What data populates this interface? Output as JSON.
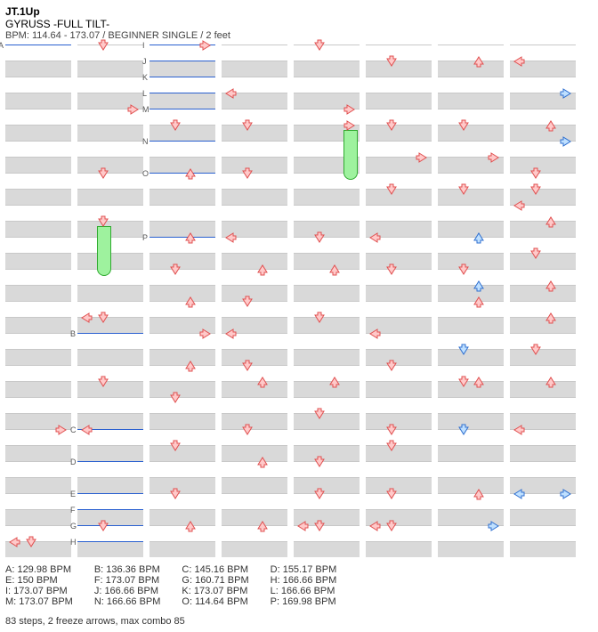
{
  "header": {
    "title": "JT.1Up",
    "song": "GYRUSS -FULL TILT-",
    "info": "BPM: 114.64 - 173.07 / BEGINNER SINGLE / 2 feet"
  },
  "layout": {
    "columns": 8,
    "beats_per_column": 32,
    "lanes": [
      "left",
      "down",
      "up",
      "right"
    ]
  },
  "labels": [
    {
      "col": 0,
      "beat": 0,
      "t": "A"
    },
    {
      "col": 1,
      "beat": 18,
      "t": "B"
    },
    {
      "col": 1,
      "beat": 24,
      "t": "C"
    },
    {
      "col": 1,
      "beat": 26,
      "t": "D"
    },
    {
      "col": 1,
      "beat": 28,
      "t": "E"
    },
    {
      "col": 1,
      "beat": 29,
      "t": "F"
    },
    {
      "col": 1,
      "beat": 30,
      "t": "G"
    },
    {
      "col": 1,
      "beat": 31,
      "t": "H"
    },
    {
      "col": 2,
      "beat": 0,
      "t": "I"
    },
    {
      "col": 2,
      "beat": 1,
      "t": "J"
    },
    {
      "col": 2,
      "beat": 2,
      "t": "K"
    },
    {
      "col": 2,
      "beat": 3,
      "t": "L"
    },
    {
      "col": 2,
      "beat": 4,
      "t": "M"
    },
    {
      "col": 2,
      "beat": 6,
      "t": "N"
    },
    {
      "col": 2,
      "beat": 8,
      "t": "O"
    },
    {
      "col": 2,
      "beat": 12,
      "t": "P"
    }
  ],
  "bpm_lines": [
    {
      "col": 0,
      "beat": 0
    },
    {
      "col": 1,
      "beat": 18
    },
    {
      "col": 1,
      "beat": 24
    },
    {
      "col": 1,
      "beat": 26
    },
    {
      "col": 1,
      "beat": 28
    },
    {
      "col": 1,
      "beat": 29
    },
    {
      "col": 1,
      "beat": 30
    },
    {
      "col": 1,
      "beat": 31
    },
    {
      "col": 2,
      "beat": 0
    },
    {
      "col": 2,
      "beat": 1
    },
    {
      "col": 2,
      "beat": 2
    },
    {
      "col": 2,
      "beat": 3
    },
    {
      "col": 2,
      "beat": 4
    },
    {
      "col": 2,
      "beat": 6
    },
    {
      "col": 2,
      "beat": 8
    },
    {
      "col": 2,
      "beat": 12
    }
  ],
  "freezes": [
    {
      "col": 1,
      "beat": 11,
      "len": 3,
      "lane": "down"
    },
    {
      "col": 4,
      "beat": 5,
      "len": 3,
      "lane": "right"
    }
  ],
  "arrows": [
    {
      "col": 0,
      "beat": 24,
      "lane": "right",
      "c": "r"
    },
    {
      "col": 0,
      "beat": 31,
      "lane": "left",
      "c": "r"
    },
    {
      "col": 0,
      "beat": 31,
      "lane": "down",
      "c": "r"
    },
    {
      "col": 1,
      "beat": 0,
      "lane": "down",
      "c": "r"
    },
    {
      "col": 1,
      "beat": 4,
      "lane": "right",
      "c": "r"
    },
    {
      "col": 1,
      "beat": 8,
      "lane": "down",
      "c": "r"
    },
    {
      "col": 1,
      "beat": 11,
      "lane": "down",
      "c": "r"
    },
    {
      "col": 1,
      "beat": 17,
      "lane": "left",
      "c": "r"
    },
    {
      "col": 1,
      "beat": 17,
      "lane": "down",
      "c": "r"
    },
    {
      "col": 1,
      "beat": 21,
      "lane": "down",
      "c": "r"
    },
    {
      "col": 1,
      "beat": 24,
      "lane": "left",
      "c": "r"
    },
    {
      "col": 1,
      "beat": 30,
      "lane": "down",
      "c": "r"
    },
    {
      "col": 2,
      "beat": 0,
      "lane": "right",
      "c": "r"
    },
    {
      "col": 2,
      "beat": 5,
      "lane": "down",
      "c": "r"
    },
    {
      "col": 2,
      "beat": 8,
      "lane": "up",
      "c": "r"
    },
    {
      "col": 2,
      "beat": 12,
      "lane": "up",
      "c": "r"
    },
    {
      "col": 2,
      "beat": 14,
      "lane": "down",
      "c": "r"
    },
    {
      "col": 2,
      "beat": 16,
      "lane": "up",
      "c": "r"
    },
    {
      "col": 2,
      "beat": 18,
      "lane": "right",
      "c": "r"
    },
    {
      "col": 2,
      "beat": 20,
      "lane": "up",
      "c": "r"
    },
    {
      "col": 2,
      "beat": 22,
      "lane": "down",
      "c": "r"
    },
    {
      "col": 2,
      "beat": 25,
      "lane": "down",
      "c": "r"
    },
    {
      "col": 2,
      "beat": 28,
      "lane": "down",
      "c": "r"
    },
    {
      "col": 2,
      "beat": 30,
      "lane": "up",
      "c": "r"
    },
    {
      "col": 3,
      "beat": 3,
      "lane": "left",
      "c": "r"
    },
    {
      "col": 3,
      "beat": 5,
      "lane": "down",
      "c": "r"
    },
    {
      "col": 3,
      "beat": 8,
      "lane": "down",
      "c": "r"
    },
    {
      "col": 3,
      "beat": 12,
      "lane": "left",
      "c": "r"
    },
    {
      "col": 3,
      "beat": 14,
      "lane": "up",
      "c": "r"
    },
    {
      "col": 3,
      "beat": 16,
      "lane": "down",
      "c": "r"
    },
    {
      "col": 3,
      "beat": 18,
      "lane": "left",
      "c": "r"
    },
    {
      "col": 3,
      "beat": 20,
      "lane": "down",
      "c": "r"
    },
    {
      "col": 3,
      "beat": 21,
      "lane": "up",
      "c": "r"
    },
    {
      "col": 3,
      "beat": 24,
      "lane": "down",
      "c": "r"
    },
    {
      "col": 3,
      "beat": 26,
      "lane": "up",
      "c": "r"
    },
    {
      "col": 3,
      "beat": 30,
      "lane": "up",
      "c": "r"
    },
    {
      "col": 4,
      "beat": 0,
      "lane": "down",
      "c": "r"
    },
    {
      "col": 4,
      "beat": 4,
      "lane": "right",
      "c": "r"
    },
    {
      "col": 4,
      "beat": 5,
      "lane": "right",
      "c": "r"
    },
    {
      "col": 4,
      "beat": 12,
      "lane": "down",
      "c": "r"
    },
    {
      "col": 4,
      "beat": 14,
      "lane": "up",
      "c": "r"
    },
    {
      "col": 4,
      "beat": 17,
      "lane": "down",
      "c": "r"
    },
    {
      "col": 4,
      "beat": 21,
      "lane": "up",
      "c": "r"
    },
    {
      "col": 4,
      "beat": 23,
      "lane": "down",
      "c": "r"
    },
    {
      "col": 4,
      "beat": 26,
      "lane": "down",
      "c": "r"
    },
    {
      "col": 4,
      "beat": 28,
      "lane": "down",
      "c": "r"
    },
    {
      "col": 4,
      "beat": 30,
      "lane": "left",
      "c": "r"
    },
    {
      "col": 4,
      "beat": 30,
      "lane": "down",
      "c": "r"
    },
    {
      "col": 5,
      "beat": 1,
      "lane": "down",
      "c": "r"
    },
    {
      "col": 5,
      "beat": 5,
      "lane": "down",
      "c": "r"
    },
    {
      "col": 5,
      "beat": 7,
      "lane": "right",
      "c": "r"
    },
    {
      "col": 5,
      "beat": 9,
      "lane": "down",
      "c": "r"
    },
    {
      "col": 5,
      "beat": 12,
      "lane": "left",
      "c": "r"
    },
    {
      "col": 5,
      "beat": 14,
      "lane": "down",
      "c": "r"
    },
    {
      "col": 5,
      "beat": 18,
      "lane": "left",
      "c": "r"
    },
    {
      "col": 5,
      "beat": 20,
      "lane": "down",
      "c": "r"
    },
    {
      "col": 5,
      "beat": 24,
      "lane": "down",
      "c": "r"
    },
    {
      "col": 5,
      "beat": 25,
      "lane": "down",
      "c": "r"
    },
    {
      "col": 5,
      "beat": 28,
      "lane": "down",
      "c": "r"
    },
    {
      "col": 5,
      "beat": 30,
      "lane": "left",
      "c": "r"
    },
    {
      "col": 5,
      "beat": 30,
      "lane": "down",
      "c": "r"
    },
    {
      "col": 6,
      "beat": 1,
      "lane": "up",
      "c": "r"
    },
    {
      "col": 6,
      "beat": 5,
      "lane": "down",
      "c": "r"
    },
    {
      "col": 6,
      "beat": 7,
      "lane": "right",
      "c": "r"
    },
    {
      "col": 6,
      "beat": 9,
      "lane": "down",
      "c": "r"
    },
    {
      "col": 6,
      "beat": 12,
      "lane": "up",
      "c": "b"
    },
    {
      "col": 6,
      "beat": 14,
      "lane": "down",
      "c": "r"
    },
    {
      "col": 6,
      "beat": 15,
      "lane": "up",
      "c": "b"
    },
    {
      "col": 6,
      "beat": 16,
      "lane": "up",
      "c": "r"
    },
    {
      "col": 6,
      "beat": 19,
      "lane": "down",
      "c": "b"
    },
    {
      "col": 6,
      "beat": 21,
      "lane": "up",
      "c": "r"
    },
    {
      "col": 6,
      "beat": 21,
      "lane": "down",
      "c": "r"
    },
    {
      "col": 6,
      "beat": 24,
      "lane": "down",
      "c": "b"
    },
    {
      "col": 6,
      "beat": 28,
      "lane": "up",
      "c": "r"
    },
    {
      "col": 6,
      "beat": 30,
      "lane": "right",
      "c": "b"
    },
    {
      "col": 7,
      "beat": 1,
      "lane": "left",
      "c": "r"
    },
    {
      "col": 7,
      "beat": 3,
      "lane": "right",
      "c": "b"
    },
    {
      "col": 7,
      "beat": 5,
      "lane": "up",
      "c": "r"
    },
    {
      "col": 7,
      "beat": 6,
      "lane": "right",
      "c": "b"
    },
    {
      "col": 7,
      "beat": 8,
      "lane": "down",
      "c": "r"
    },
    {
      "col": 7,
      "beat": 9,
      "lane": "down",
      "c": "r"
    },
    {
      "col": 7,
      "beat": 10,
      "lane": "left",
      "c": "r"
    },
    {
      "col": 7,
      "beat": 11,
      "lane": "up",
      "c": "r"
    },
    {
      "col": 7,
      "beat": 13,
      "lane": "down",
      "c": "r"
    },
    {
      "col": 7,
      "beat": 15,
      "lane": "up",
      "c": "r"
    },
    {
      "col": 7,
      "beat": 17,
      "lane": "up",
      "c": "r"
    },
    {
      "col": 7,
      "beat": 19,
      "lane": "down",
      "c": "r"
    },
    {
      "col": 7,
      "beat": 21,
      "lane": "up",
      "c": "r"
    },
    {
      "col": 7,
      "beat": 24,
      "lane": "left",
      "c": "r"
    },
    {
      "col": 7,
      "beat": 28,
      "lane": "left",
      "c": "b"
    },
    {
      "col": 7,
      "beat": 28,
      "lane": "right",
      "c": "b"
    }
  ],
  "bpm_columns": [
    "A: 129.98 BPM\nE: 150 BPM\nI: 173.07 BPM\nM: 173.07 BPM",
    "B: 136.36 BPM\nF: 173.07 BPM\nJ: 166.66 BPM\nN: 166.66 BPM",
    "C: 145.16 BPM\nG: 160.71 BPM\nK: 173.07 BPM\nO: 114.64 BPM",
    "D: 155.17 BPM\nH: 166.66 BPM\nL: 166.66 BPM\nP: 169.98 BPM"
  ],
  "stats": "83 steps, 2 freeze arrows, max combo 85"
}
